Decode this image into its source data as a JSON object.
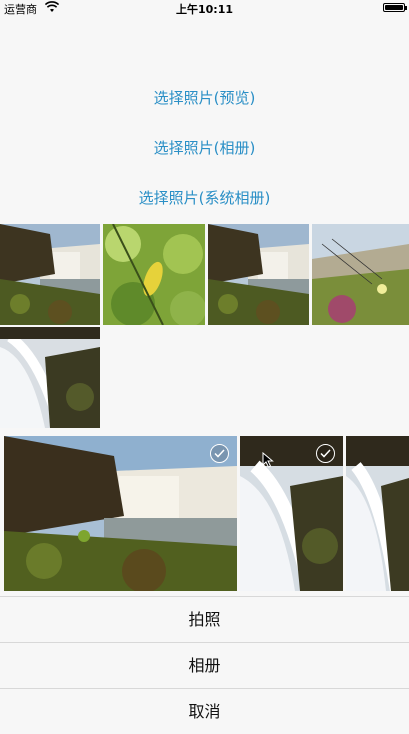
{
  "status": {
    "carrier": "运营商",
    "time": "上午10:11"
  },
  "links": {
    "preview": "选择照片(预览)",
    "album": "选择照片(相册)",
    "system_album": "选择照片(系统相册)"
  },
  "sheet": {
    "take_photo": "拍照",
    "album": "相册",
    "cancel": "取消"
  },
  "icons": [
    "wifi-icon",
    "battery-icon",
    "checkmark-icon",
    "cursor-icon"
  ]
}
